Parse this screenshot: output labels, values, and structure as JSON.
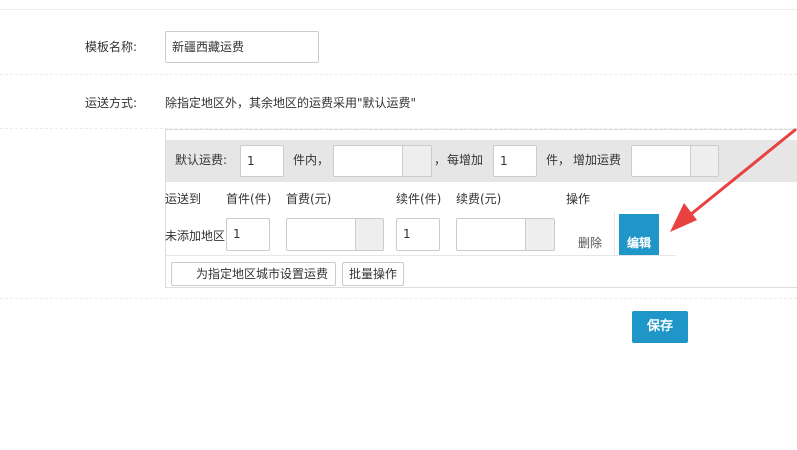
{
  "form": {
    "template_name_label": "模板名称:",
    "template_name_value": "新疆西藏运费",
    "shipping_method_label": "运送方式:",
    "shipping_method_desc": "除指定地区外，其余地区的运费采用\"默认运费\""
  },
  "default_rate": {
    "label": "默认运费:",
    "first_qty": "1",
    "unit_within": "件内，",
    "first_fee": "",
    "comma": "，",
    "each_add_label": "每增加",
    "add_qty": "1",
    "unit_piece": "件，",
    "add_fee_label": "增加运费",
    "add_fee": ""
  },
  "area_table": {
    "headers": [
      "运送到",
      "首件(件)",
      "首费(元)",
      "续件(件)",
      "续费(元)",
      "操作"
    ],
    "rows": [
      {
        "region": "未添加地区",
        "first_qty": "1",
        "first_fee": "",
        "add_qty": "1",
        "add_fee": "",
        "delete_label": "删除",
        "edit_label": "编辑"
      }
    ]
  },
  "actions": {
    "set_city_rate_label": "为指定地区城市设置运费",
    "batch_label": "批量操作",
    "save_label": "保存"
  },
  "colors": {
    "primary": "#1e96c8",
    "annotation_arrow": "#e8413f"
  }
}
